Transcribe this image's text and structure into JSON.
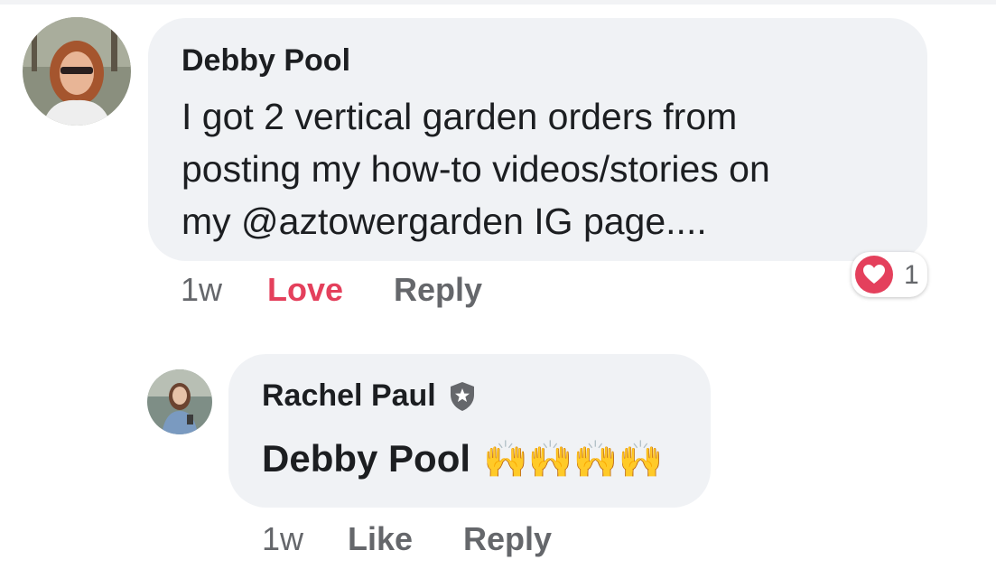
{
  "comment": {
    "author": "Debby Pool",
    "text_lines": [
      "I got 2 vertical garden orders from",
      "posting my how-to videos/stories on",
      "my @aztowergarden IG page...."
    ],
    "time": "1w",
    "reaction_label": "Love",
    "reply_label": "Reply",
    "reaction_count": "1",
    "reaction_icon": "heart-icon",
    "reaction_color": "#e4405c"
  },
  "reply": {
    "author": "Rachel Paul",
    "badge_icon": "star-shield-icon",
    "mention": "Debby Pool",
    "emoji": "🙌🙌🙌🙌",
    "time": "1w",
    "like_label": "Like",
    "reply_label": "Reply"
  }
}
